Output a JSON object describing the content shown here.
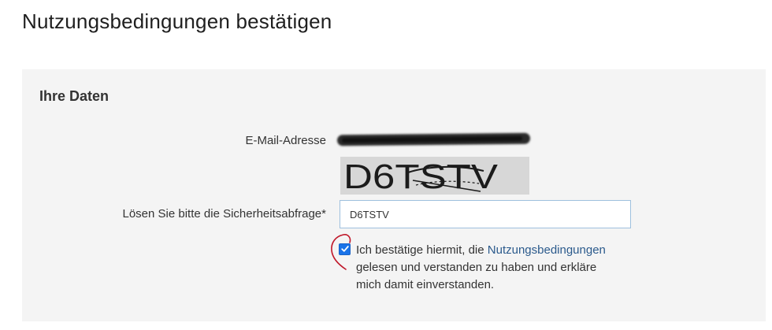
{
  "page": {
    "title": "Nutzungsbedingungen bestätigen"
  },
  "section": {
    "title": "Ihre Daten"
  },
  "email": {
    "label": "E-Mail-Adresse"
  },
  "captcha": {
    "image_text": "D6TSTV",
    "label": "Lösen Sie bitte die Sicherheitsabfrage*",
    "input_value": "D6TSTV"
  },
  "consent": {
    "checked": true,
    "text_before_link": "Ich bestätige hiermit, die ",
    "link_text": "Nutzungsbedingungen",
    "text_after_link": " gelesen und verstanden zu haben und erkläre mich damit einverstanden."
  },
  "colors": {
    "link": "#2b5a8c",
    "checkbox": "#1a73e8",
    "annotation": "#c0182a",
    "panel_background": "#f4f4f4"
  }
}
